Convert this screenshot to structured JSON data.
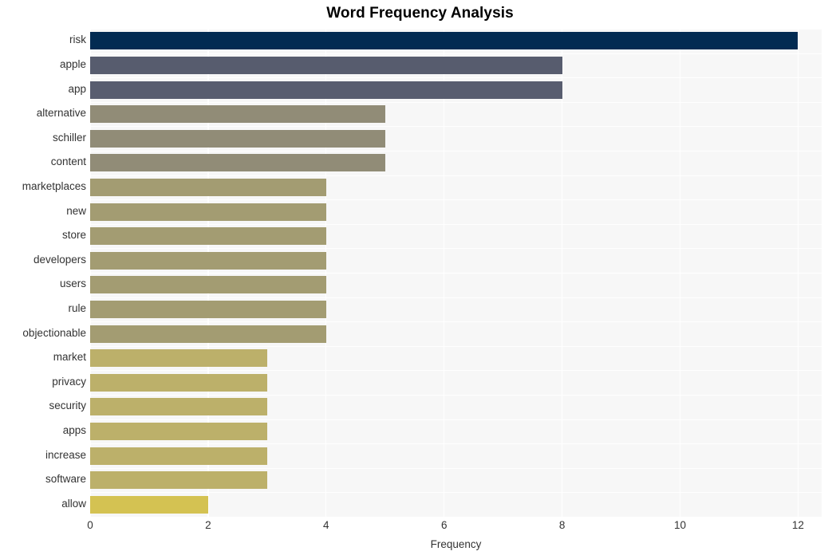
{
  "chart_data": {
    "type": "bar",
    "orientation": "horizontal",
    "title": "Word Frequency Analysis",
    "xlabel": "Frequency",
    "ylabel": "",
    "xlim": [
      0,
      12.4
    ],
    "xticks": [
      0,
      2,
      4,
      6,
      8,
      10,
      12
    ],
    "xticklabels": [
      "0",
      "2",
      "4",
      "6",
      "8",
      "10",
      "12"
    ],
    "grid": true,
    "grid_color": "#ffffff",
    "plot_background": "#f7f7f7",
    "legend": null,
    "categories": [
      "risk",
      "apple",
      "app",
      "alternative",
      "schiller",
      "content",
      "marketplaces",
      "new",
      "store",
      "developers",
      "users",
      "rule",
      "objectionable",
      "market",
      "privacy",
      "security",
      "apps",
      "increase",
      "software",
      "allow"
    ],
    "values": [
      12,
      8,
      8,
      5,
      5,
      5,
      4,
      4,
      4,
      4,
      4,
      4,
      4,
      3,
      3,
      3,
      3,
      3,
      3,
      2
    ],
    "bar_colors": [
      "#022b52",
      "#575c6e",
      "#585d6f",
      "#918c77",
      "#918c77",
      "#918c77",
      "#a39c72",
      "#a39c72",
      "#a39c72",
      "#a39c72",
      "#a39c72",
      "#a39c72",
      "#a39c72",
      "#bcb06a",
      "#bcb06a",
      "#bcb06a",
      "#bcb06a",
      "#bcb06a",
      "#bcb06a",
      "#d4c252"
    ]
  },
  "figure": {
    "title": "Word Frequency Analysis",
    "axis_title_x": "Frequency"
  }
}
